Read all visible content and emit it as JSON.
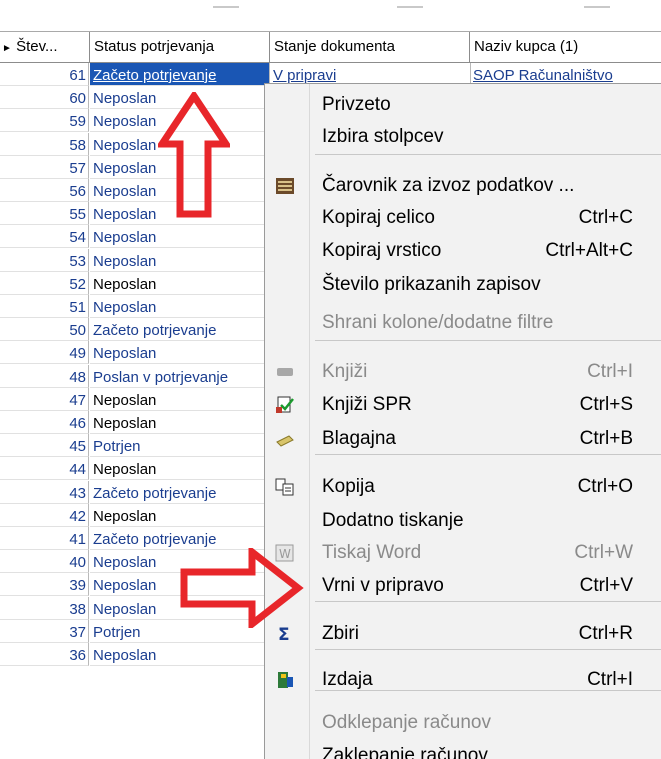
{
  "columns": {
    "number": "Štev...",
    "status": "Status potrjevanja",
    "state": "Stanje dokumenta",
    "customer": "Naziv kupca (1)"
  },
  "rows": [
    {
      "num": "61",
      "status": "Začeto potrjevanje",
      "selected": true
    },
    {
      "num": "60",
      "status": "Neposlan"
    },
    {
      "num": "59",
      "status": "Neposlan"
    },
    {
      "num": "58",
      "status": "Neposlan"
    },
    {
      "num": "57",
      "status": "Neposlan"
    },
    {
      "num": "56",
      "status": "Neposlan"
    },
    {
      "num": "55",
      "status": "Neposlan"
    },
    {
      "num": "54",
      "status": "Neposlan"
    },
    {
      "num": "53",
      "status": "Neposlan"
    },
    {
      "num": "52",
      "status": "Neposlan",
      "black": true
    },
    {
      "num": "51",
      "status": "Neposlan"
    },
    {
      "num": "50",
      "status": "Začeto potrjevanje"
    },
    {
      "num": "49",
      "status": "Neposlan"
    },
    {
      "num": "48",
      "status": "Poslan v potrjevanje"
    },
    {
      "num": "47",
      "status": "Neposlan",
      "black": true
    },
    {
      "num": "46",
      "status": "Neposlan",
      "black": true
    },
    {
      "num": "45",
      "status": "Potrjen"
    },
    {
      "num": "44",
      "status": "Neposlan",
      "black": true
    },
    {
      "num": "43",
      "status": "Začeto potrjevanje"
    },
    {
      "num": "42",
      "status": "Neposlan",
      "black": true
    },
    {
      "num": "41",
      "status": "Začeto potrjevanje"
    },
    {
      "num": "40",
      "status": "Neposlan"
    },
    {
      "num": "39",
      "status": "Neposlan"
    },
    {
      "num": "38",
      "status": "Neposlan"
    },
    {
      "num": "37",
      "status": "Potrjen"
    },
    {
      "num": "36",
      "status": "Neposlan"
    }
  ],
  "first_row_peek": {
    "state": "V pripravi",
    "customer": "SAOP Računalništvo"
  },
  "menu": {
    "items": [
      {
        "label": "Privzeto",
        "shortcut": "",
        "icon": "",
        "disabled": false
      },
      {
        "label": "Izbira stolpcev",
        "shortcut": "",
        "icon": "",
        "disabled": false
      },
      {
        "label": "Čarovnik za izvoz podatkov ...",
        "shortcut": "",
        "icon": "export-wizard-icon",
        "disabled": false
      },
      {
        "label": "Kopiraj celico",
        "shortcut": "Ctrl+C",
        "icon": "",
        "disabled": false
      },
      {
        "label": "Kopiraj vrstico",
        "shortcut": "Ctrl+Alt+C",
        "icon": "",
        "disabled": false
      },
      {
        "label": "Število prikazanih zapisov",
        "shortcut": "",
        "icon": "",
        "disabled": false
      },
      {
        "label": "Shrani kolone/dodatne filtre",
        "shortcut": "",
        "icon": "",
        "disabled": true
      },
      {
        "label": "Knjiži",
        "shortcut": "Ctrl+I",
        "icon": "post-icon",
        "disabled": true
      },
      {
        "label": "Knjiži SPR",
        "shortcut": "Ctrl+S",
        "icon": "post-spr-icon",
        "disabled": false
      },
      {
        "label": "Blagajna",
        "shortcut": "Ctrl+B",
        "icon": "cash-register-icon",
        "disabled": false
      },
      {
        "label": "Kopija",
        "shortcut": "Ctrl+O",
        "icon": "copy-documents-icon",
        "disabled": false
      },
      {
        "label": "Dodatno tiskanje",
        "shortcut": "",
        "icon": "",
        "disabled": false
      },
      {
        "label": "Tiskaj Word",
        "shortcut": "Ctrl+W",
        "icon": "word-icon",
        "disabled": true
      },
      {
        "label": "Vrni v pripravo",
        "shortcut": "Ctrl+V",
        "icon": "",
        "disabled": false
      },
      {
        "label": "Zbiri",
        "shortcut": "Ctrl+R",
        "icon": "sigma-icon",
        "disabled": false
      },
      {
        "label": "Izdaja",
        "shortcut": "Ctrl+I",
        "icon": "issue-icon",
        "disabled": false
      },
      {
        "label": "Odklepanje računov",
        "shortcut": "",
        "icon": "",
        "disabled": true
      },
      {
        "label": "Zaklepanje računov",
        "shortcut": "",
        "icon": "",
        "disabled": false
      }
    ]
  },
  "colors": {
    "selection": "#1a56b4",
    "link_text": "#1a3d8f",
    "annotation_arrow": "#e8262a",
    "menu_bg": "#f2f2f2"
  }
}
